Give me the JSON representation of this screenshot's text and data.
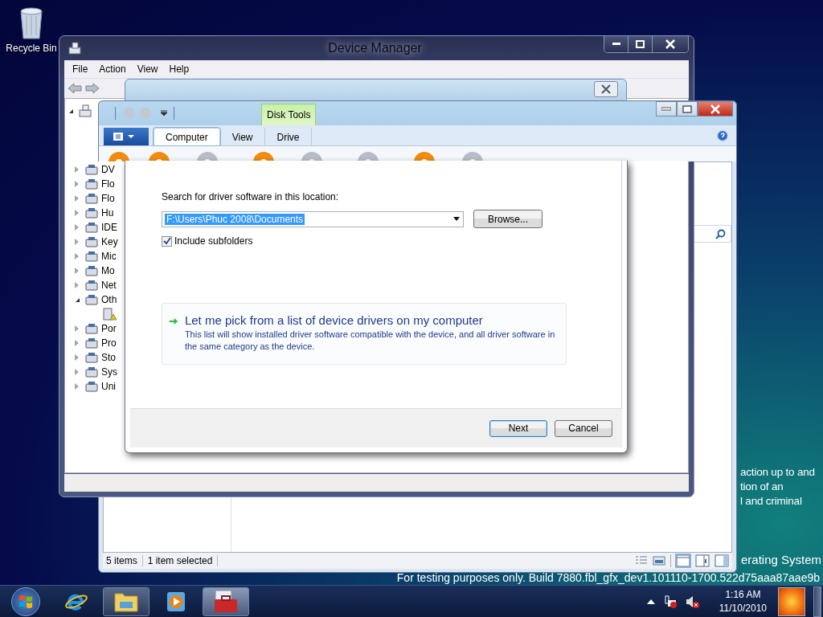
{
  "desktop": {
    "icons": [
      {
        "label": "Recycle Bin"
      }
    ],
    "desktop_text": {
      "side_lines": [
        "action up to and",
        "tion of an",
        "l and criminal"
      ],
      "edition_line": "erating System",
      "build_line": "For testing purposes only. Build 7880.fbl_gfx_dev1.101110-1700.522d75aaa87aae9b"
    }
  },
  "device_manager": {
    "title": "Device Manager",
    "menu": [
      "File",
      "Action",
      "View",
      "Help"
    ],
    "tree": {
      "expanded": true,
      "children": [
        {
          "label": "DV",
          "expanded": false
        },
        {
          "label": "Flo",
          "expanded": false
        },
        {
          "label": "Flo",
          "expanded": false
        },
        {
          "label": "Hu",
          "expanded": false
        },
        {
          "label": "IDE",
          "expanded": false
        },
        {
          "label": "Key",
          "expanded": false
        },
        {
          "label": "Mic",
          "expanded": false
        },
        {
          "label": "Mo",
          "expanded": false
        },
        {
          "label": "Net",
          "expanded": false
        },
        {
          "label": "Oth",
          "expanded": true,
          "children": [
            {
              "warning": true
            }
          ]
        },
        {
          "label": "Por",
          "expanded": false
        },
        {
          "label": "Pro",
          "expanded": false
        },
        {
          "label": "Sto",
          "expanded": false
        },
        {
          "label": "Sys",
          "expanded": false
        },
        {
          "label": "Uni",
          "expanded": false
        }
      ]
    }
  },
  "explorer": {
    "contextual_tab": "Disk Tools",
    "tabs": [
      {
        "label": "Computer",
        "selected": true
      },
      {
        "label": "View",
        "selected": false
      },
      {
        "label": "Drive",
        "selected": false
      }
    ],
    "status_bar": [
      "5 items",
      "1 item selected"
    ]
  },
  "driver_wizard": {
    "search_label": "Search for driver software in this location:",
    "location": {
      "value": "F:\\Users\\Phuc 2008\\Documents",
      "selected": true
    },
    "browse_button": "Browse...",
    "include_subfolders": {
      "label": "Include subfolders",
      "checked": true
    },
    "pick_option": {
      "title": "Let me pick from a list of device drivers on my computer",
      "description": "This list will show installed driver software compatible with the device, and all driver software in the same category as the device."
    },
    "buttons": [
      {
        "label": "Next",
        "default": true
      },
      {
        "label": "Cancel",
        "default": false
      }
    ]
  },
  "taskbar": {
    "apps": [
      {
        "kind": "browser",
        "running": false
      },
      {
        "kind": "folder",
        "running": true
      },
      {
        "kind": "media",
        "running": false
      },
      {
        "kind": "toolbox",
        "running": true
      }
    ],
    "clock": {
      "time": "1:16 AM",
      "date": "11/10/2010"
    }
  }
}
